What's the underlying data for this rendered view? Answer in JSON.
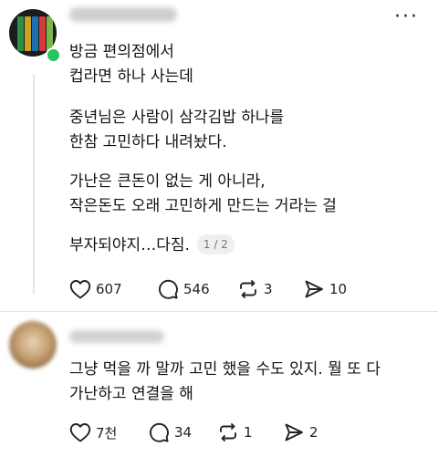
{
  "colors": {
    "online": "#22c55e",
    "text": "#121212",
    "muted": "#777777",
    "divider": "#e3e3e3"
  },
  "post": {
    "more_icon": "more-horizontal-icon",
    "lines": [
      "방금 편의점에서",
      "컵라면 하나 사는데",
      "중년님은 사람이 삼각김밥 하나를",
      "한참 고민하다 내려놨다.",
      "가난은 큰돈이 없는 게 아니라,",
      "작은돈도 오래 고민하게 만드는 거라는 걸",
      "부자되야지…다짐."
    ],
    "page_indicator": "1 / 2",
    "stats": {
      "likes": "607",
      "comments": "546",
      "reposts": "3",
      "shares": "10"
    }
  },
  "reply": {
    "lines": [
      "그냥 먹을 까 말까 고민 했을 수도 있지. 뭘 또 다",
      "가난하고 연결을 해"
    ],
    "stats": {
      "likes": "7천",
      "comments": "34",
      "reposts": "1",
      "shares": "2"
    }
  }
}
